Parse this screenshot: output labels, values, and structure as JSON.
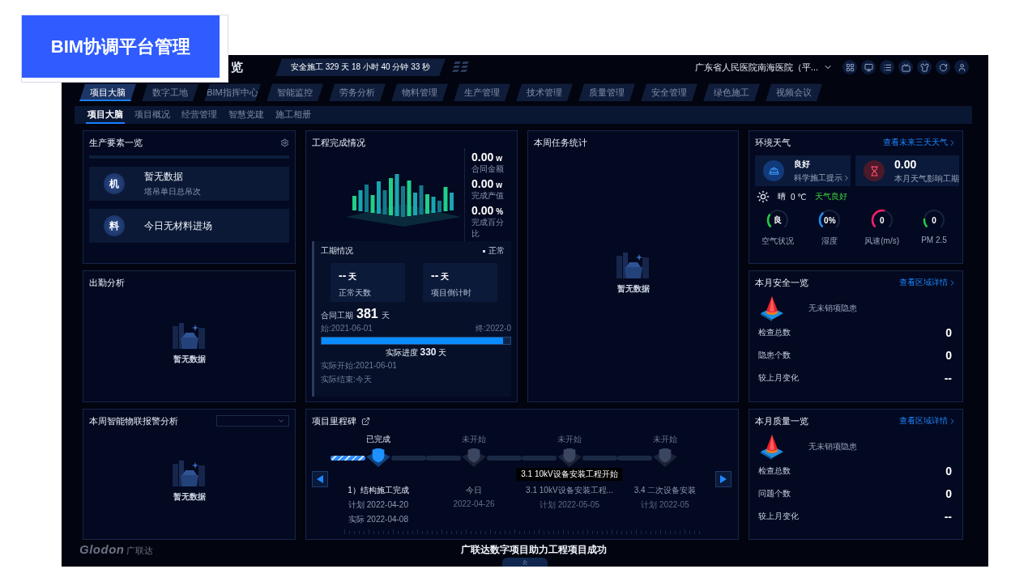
{
  "overlay_label": {
    "text": "BIM协调平台管理"
  },
  "header": {
    "title": "览",
    "safety_timer": "安全施工 329 天 18 小时 40 分钟 33 秒",
    "project_selector": "广东省人民医院南海医院（平..."
  },
  "toolbar_icons": [
    {
      "kind": "grid"
    },
    {
      "kind": "monitor"
    },
    {
      "kind": "list"
    },
    {
      "kind": "screen"
    },
    {
      "kind": "shirt"
    },
    {
      "kind": "refresh"
    },
    {
      "kind": "user"
    }
  ],
  "nav_tabs": [
    {
      "label": "项目大脑",
      "selected": true
    },
    {
      "label": "数字工地",
      "selected": false
    },
    {
      "label": "BIM指挥中心",
      "selected": false
    },
    {
      "label": "智能监控",
      "selected": false
    },
    {
      "label": "劳务分析",
      "selected": false
    },
    {
      "label": "物料管理",
      "selected": false
    },
    {
      "label": "生产管理",
      "selected": false
    },
    {
      "label": "技术管理",
      "selected": false
    },
    {
      "label": "质量管理",
      "selected": false
    },
    {
      "label": "安全管理",
      "selected": false
    },
    {
      "label": "绿色施工",
      "selected": false
    },
    {
      "label": "视频会议",
      "selected": false
    }
  ],
  "sub_tabs": [
    {
      "label": "项目大脑",
      "selected": true
    },
    {
      "label": "项目概况",
      "selected": false
    },
    {
      "label": "经营管理",
      "selected": false
    },
    {
      "label": "智慧党建",
      "selected": false
    },
    {
      "label": "施工相册",
      "selected": false
    }
  ],
  "production": {
    "title": "生产要素一览",
    "items": [
      {
        "badge": "机",
        "title": "暂无数据",
        "subtitle": "塔吊单日总吊次"
      },
      {
        "badge": "料",
        "title": "今日无材料进场"
      }
    ]
  },
  "completion": {
    "title": "工程完成情况",
    "stats": [
      {
        "value": "0.00",
        "unit": "w",
        "label": "合同金额"
      },
      {
        "value": "0.00",
        "unit": "w",
        "label": "完成产值"
      },
      {
        "value": "0.00",
        "unit": "%",
        "label": "完成百分比"
      }
    ],
    "schedule": {
      "title": "工期情况",
      "status": "正常",
      "cards": [
        {
          "value": "--",
          "unit": "天",
          "label": "正常天数"
        },
        {
          "value": "--",
          "unit": "天",
          "label": "项目倒计时"
        }
      ],
      "contract_label": "合同工期",
      "contract_days": "381",
      "contract_unit": "天",
      "start": "始:2021-06-01",
      "end": "终:2022-0",
      "progress_label": "实际进度",
      "progress_days": "330",
      "progress_unit": "天",
      "level": 0.96,
      "actual_start": "实际开始:2021-06-01",
      "actual_end": "实际结束:今天"
    }
  },
  "weekly_tasks": {
    "title": "本周任务统计",
    "empty": "暂无数据"
  },
  "weather": {
    "title": "环境天气",
    "link": "查看未来三天天气",
    "cards": [
      {
        "kind": "worker",
        "value": "良好",
        "label": "科学施工提示"
      },
      {
        "kind": "hourglass",
        "value": "0.00",
        "label": "本月天气影响工期"
      }
    ],
    "condition": "晴",
    "temperature": "0 ℃",
    "status": "天气良好",
    "gauges": [
      {
        "value": "良",
        "label": "空气状况",
        "color": "#22cc44",
        "level": 0.3
      },
      {
        "value": "0%",
        "label": "湿度",
        "color": "#1e90ff",
        "level": 0.35
      },
      {
        "value": "0",
        "label": "风速(m/s)",
        "color": "#ff1f6a",
        "level": 0.55
      },
      {
        "value": "0",
        "label": "PM 2.5",
        "color": "#22cc44",
        "level": 0.2
      }
    ]
  },
  "attendance": {
    "title": "出勤分析",
    "empty": "暂无数据"
  },
  "safety": {
    "title": "本月安全一览",
    "link": "查看区域详情",
    "note": "无未销项隐患",
    "rows": [
      {
        "label": "检查总数",
        "value": "0"
      },
      {
        "label": "隐患个数",
        "value": "0"
      },
      {
        "label": "较上月变化",
        "value": "--"
      }
    ]
  },
  "alarm": {
    "title": "本周智能物联报警分析",
    "empty": "暂无数据"
  },
  "milestones": {
    "title": "项目里程碑",
    "items": [
      {
        "status": "已完成",
        "done": true,
        "name": "1）结构施工完成",
        "dates": [
          {
            "label": "计划",
            "date": "2022-04-20"
          },
          {
            "label": "实际",
            "date": "2022-04-08"
          }
        ]
      },
      {
        "status": "未开始",
        "done": false,
        "name": "今日",
        "dates": [
          {
            "date": "2022-04-26"
          }
        ]
      },
      {
        "status": "未开始",
        "done": false,
        "name": "3.1 10kV设备安装工程...",
        "dates": [
          {
            "label": "计划",
            "date": "2022-05-05"
          }
        ],
        "tooltip": "3.1 10kV设备安装工程开始"
      },
      {
        "status": "未开始",
        "done": false,
        "name": "3.4 二次设备安装",
        "dates": [
          {
            "label": "计划",
            "date": "2022-05"
          }
        ]
      }
    ]
  },
  "quality": {
    "title": "本月质量一览",
    "link": "查看区域详情",
    "note": "无未销项隐患",
    "rows": [
      {
        "label": "检查总数",
        "value": "0"
      },
      {
        "label": "问题个数",
        "value": "0"
      },
      {
        "label": "较上月变化",
        "value": "--"
      }
    ]
  },
  "footer": {
    "logo": "Glodon",
    "logo_cn": "广联达",
    "slogan": "广联达数字项目助力工程项目成功"
  }
}
